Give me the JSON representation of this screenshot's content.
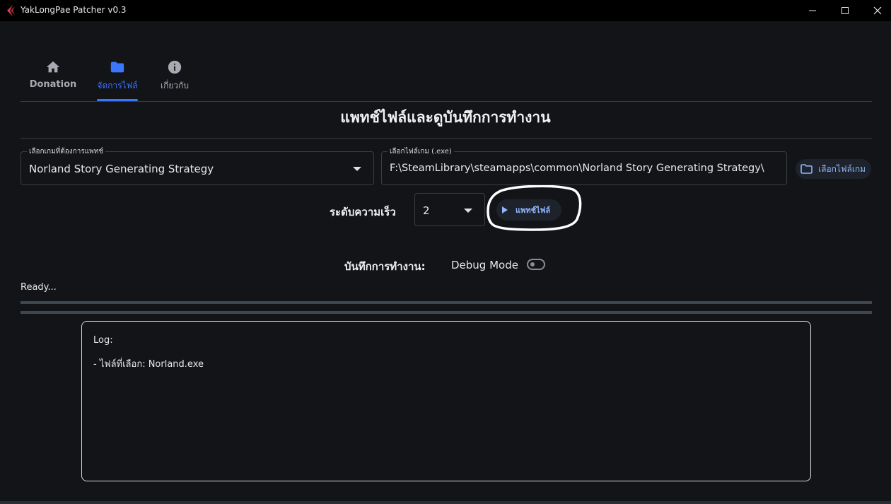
{
  "window": {
    "title": "YakLongPae Patcher v0.3",
    "controls": [
      "minimize-icon",
      "maximize-icon",
      "close-icon"
    ]
  },
  "tabs": [
    {
      "label": "Donation",
      "icon": "home-icon",
      "selected": false
    },
    {
      "label": "จัดการไฟล์",
      "icon": "folder-icon",
      "selected": true
    },
    {
      "label": "เกี่ยวกับ",
      "icon": "info-icon",
      "selected": false
    }
  ],
  "page": {
    "title": "แพทช์ไฟล์และดูบันทึกการทำงาน"
  },
  "game_select": {
    "label": "เลือกเกมที่ต้องการแพทช์",
    "value": "Norland Story Generating Strategy"
  },
  "exe_field": {
    "label": "เลือกไฟล์เกม (.exe)",
    "value": "F:\\SteamLibrary\\steamapps\\common\\Norland Story Generating Strategy\\"
  },
  "browse_button": {
    "label": "เลือกไฟล์เกม",
    "icon": "folder-outline-icon"
  },
  "speed": {
    "label": "ระดับความเร็ว",
    "value": "2"
  },
  "patch_button": {
    "label": "แพทช์ไฟล์",
    "icon": "play-icon"
  },
  "log_controls": {
    "heading": "บันทึกการทำงาน:",
    "debug_label": "Debug Mode",
    "debug_enabled": false
  },
  "status": {
    "text": "Ready..."
  },
  "log": {
    "title": "Log:",
    "lines": [
      "- ไฟล์ที่เลือก: Norland.exe"
    ]
  },
  "colors": {
    "background": "#121418",
    "titlebar": "#000000",
    "accent": "#3b76ff",
    "button_text": "#8fb6ff",
    "annotation": "#ffffff"
  }
}
